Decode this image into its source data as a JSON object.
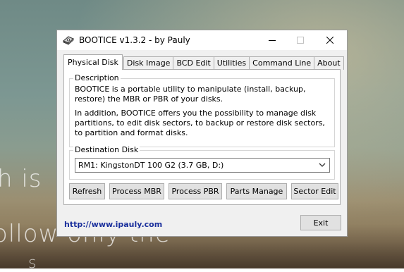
{
  "window": {
    "title": "BOOTICE v1.3.2 - by Pauly",
    "icon": "bootice-app-icon"
  },
  "background": {
    "lines": [
      "h is",
      "ollow only the",
      "s"
    ]
  },
  "tabs": [
    {
      "label": "Physical Disk",
      "active": true
    },
    {
      "label": "Disk Image",
      "active": false
    },
    {
      "label": "BCD Edit",
      "active": false
    },
    {
      "label": "Utilities",
      "active": false
    },
    {
      "label": "Command Line",
      "active": false
    },
    {
      "label": "About",
      "active": false
    }
  ],
  "description": {
    "label": "Description",
    "paragraphs": [
      "BOOTICE is a portable utility to manipulate (install, backup, restore) the MBR or PBR of your disks.",
      "In addition, BOOTICE offers you the possibility to manage disk partitions, to edit disk sectors, to backup or restore disk sectors, to partition and format disks."
    ]
  },
  "destination": {
    "label": "Destination Disk",
    "selected": "RM1: KingstonDT 100 G2 (3.7 GB, D:)"
  },
  "buttons": {
    "refresh": "Refresh",
    "process_mbr": "Process MBR",
    "process_pbr": "Process PBR",
    "parts_manage": "Parts Manage",
    "sector_edit": "Sector Edit"
  },
  "footer": {
    "url": "http://www.ipauly.com",
    "exit": "Exit"
  },
  "colors": {
    "link": "#1a2f9c",
    "button_bg": "#e1e1e1",
    "window_bg": "#f0f0f0"
  }
}
